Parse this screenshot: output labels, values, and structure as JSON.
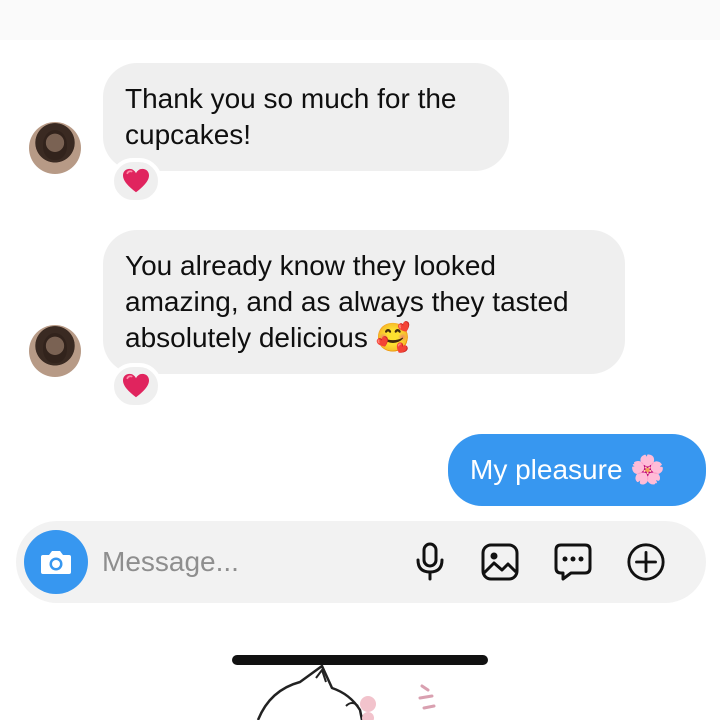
{
  "messages": [
    {
      "direction": "incoming",
      "text": "Thank you so much for the cupcakes!",
      "reaction": "❤️"
    },
    {
      "direction": "incoming",
      "text": "You already know they looked amazing, and as always they tasted absolutely delicious 🥰",
      "reaction": "❤️"
    },
    {
      "direction": "outgoing",
      "text": "My pleasure 🌸"
    }
  ],
  "composer": {
    "placeholder": "Message...",
    "icons": [
      "camera-icon",
      "microphone-icon",
      "image-icon",
      "sticker-chat-icon",
      "plus-circle-icon"
    ]
  },
  "colors": {
    "accent": "#3797f0",
    "incoming_bubble": "#efefef",
    "reaction_heart": "#e0245e"
  }
}
